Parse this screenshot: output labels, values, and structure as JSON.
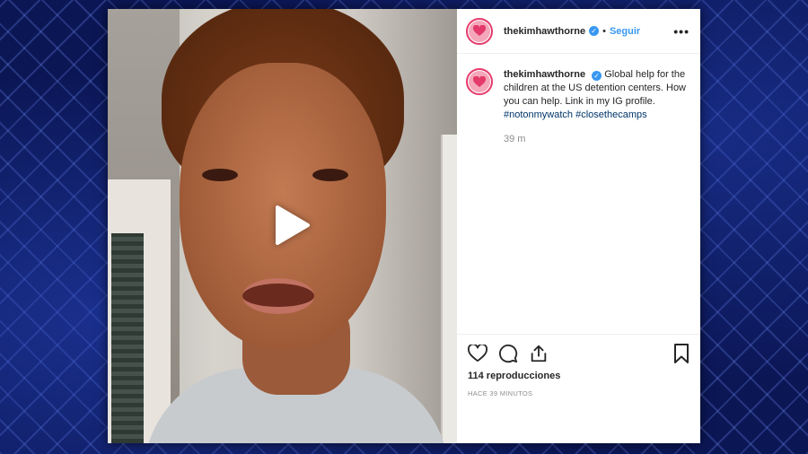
{
  "post": {
    "username": "thekimhawthorne",
    "follow_label": "Seguir",
    "separator": "•",
    "more_label": "•••",
    "verified_glyph": "✓"
  },
  "caption": {
    "username": "thekimhawthorne",
    "text": "Global help for the children at the US detention centers. How you can help. Link in my IG profile.",
    "hashtags": [
      "#notonmywatch",
      "#closethecamps"
    ],
    "age": "39 m"
  },
  "stats": {
    "views": "114 reproducciones",
    "timestamp": "HACE 39 MINUTOS"
  },
  "icons": {
    "like": "heart-icon",
    "comment": "comment-icon",
    "share": "share-icon",
    "save": "bookmark-icon",
    "play": "play-icon"
  },
  "colors": {
    "accent": "#3897f0",
    "avatar_ring": "#e43a6a",
    "hashtag": "#003569",
    "backdrop": "#0b1655"
  }
}
